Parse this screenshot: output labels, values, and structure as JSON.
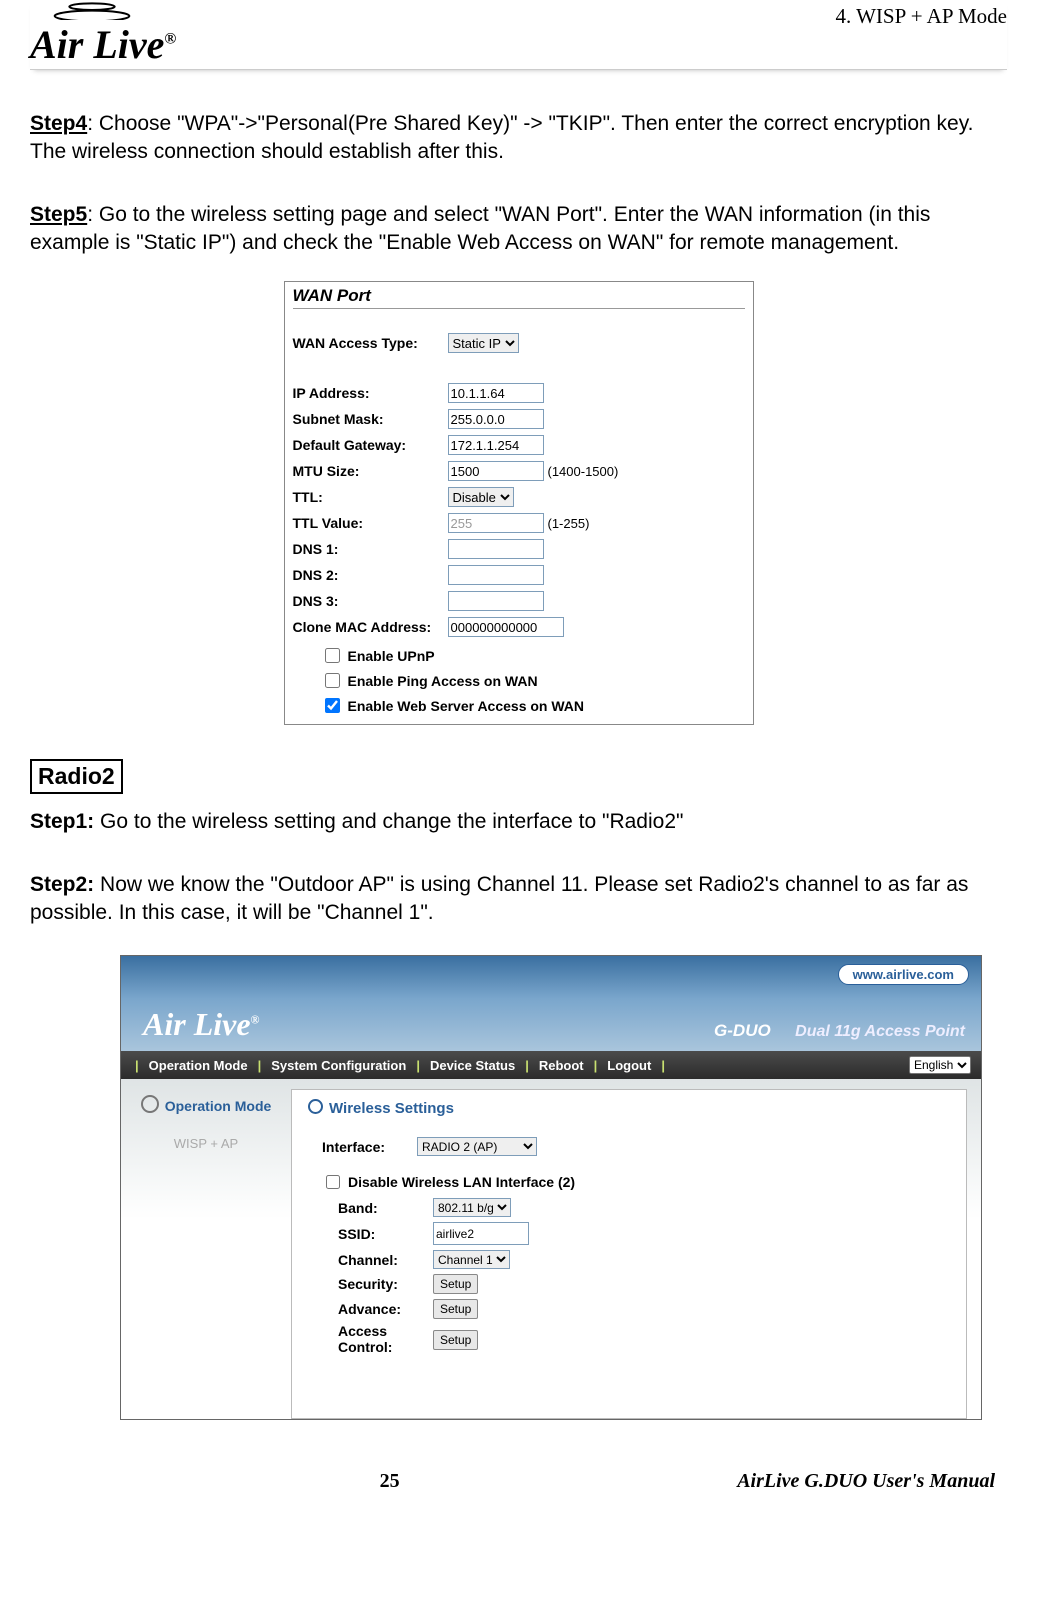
{
  "header": {
    "chapter": "4. WISP + AP Mode",
    "logo_text": "Air Live",
    "logo_reg": "®"
  },
  "steps": {
    "s4_label": "Step4",
    "s4_text": ": Choose \"WPA\"->\"Personal(Pre Shared Key)\" -> \"TKIP\".    Then enter the correct encryption key.    The wireless connection should establish after this.",
    "s5_label": "Step5",
    "s5_text": ": Go to the wireless setting page and select \"WAN Port\".    Enter the WAN information (in this example is \"Static IP\") and check the \"Enable Web Access on WAN\" for remote management.",
    "radio2_heading": "Radio2",
    "r2s1_label": "Step1:",
    "r2s1_text": " Go to the wireless setting and change the interface to \"Radio2\"",
    "r2s2_label": "Step2:",
    "r2s2_text": " Now we know the \"Outdoor AP\" is using Channel 11.    Please set Radio2's channel to as far as possible.    In this case, it will be \"Channel 1\"."
  },
  "wan": {
    "title": "WAN Port",
    "access_label": "WAN Access Type:",
    "access_value": "Static IP",
    "ip_label": "IP Address:",
    "ip_value": "10.1.1.64",
    "mask_label": "Subnet Mask:",
    "mask_value": "255.0.0.0",
    "gw_label": "Default Gateway:",
    "gw_value": "172.1.1.254",
    "mtu_label": "MTU Size:",
    "mtu_value": "1500",
    "mtu_range": "(1400-1500)",
    "ttl_label": "TTL:",
    "ttl_value": "Disable",
    "ttlv_label": "TTL Value:",
    "ttlv_value": "255",
    "ttlv_range": "(1-255)",
    "dns1_label": "DNS 1:",
    "dns2_label": "DNS 2:",
    "dns3_label": "DNS 3:",
    "clone_label": "Clone MAC Address:",
    "clone_value": "000000000000",
    "upnp": "Enable UPnP",
    "ping": "Enable Ping Access on WAN",
    "web": "Enable Web Server Access on WAN"
  },
  "al": {
    "url": "www.airlive.com",
    "prod_model": "G-DUO",
    "prod_desc": "Dual 11g Access Point",
    "menu": {
      "op": "Operation Mode",
      "sys": "System Configuration",
      "dev": "Device Status",
      "reboot": "Reboot",
      "logout": "Logout",
      "lang": "English"
    },
    "side": {
      "op": "Operation Mode",
      "mode": "WISP + AP"
    },
    "ws": {
      "title": "Wireless Settings",
      "iface_label": "Interface:",
      "iface_value": "RADIO 2 (AP)",
      "disable": "Disable Wireless LAN Interface (2)",
      "band_label": "Band:",
      "band_value": "802.11 b/g",
      "ssid_label": "SSID:",
      "ssid_value": "airlive2",
      "chan_label": "Channel:",
      "chan_value": "Channel 1",
      "sec_label": "Security:",
      "adv_label": "Advance:",
      "acc_label": "Access Control:",
      "setup": "Setup"
    }
  },
  "footer": {
    "page": "25",
    "manual": "AirLive G.DUO User's Manual"
  }
}
